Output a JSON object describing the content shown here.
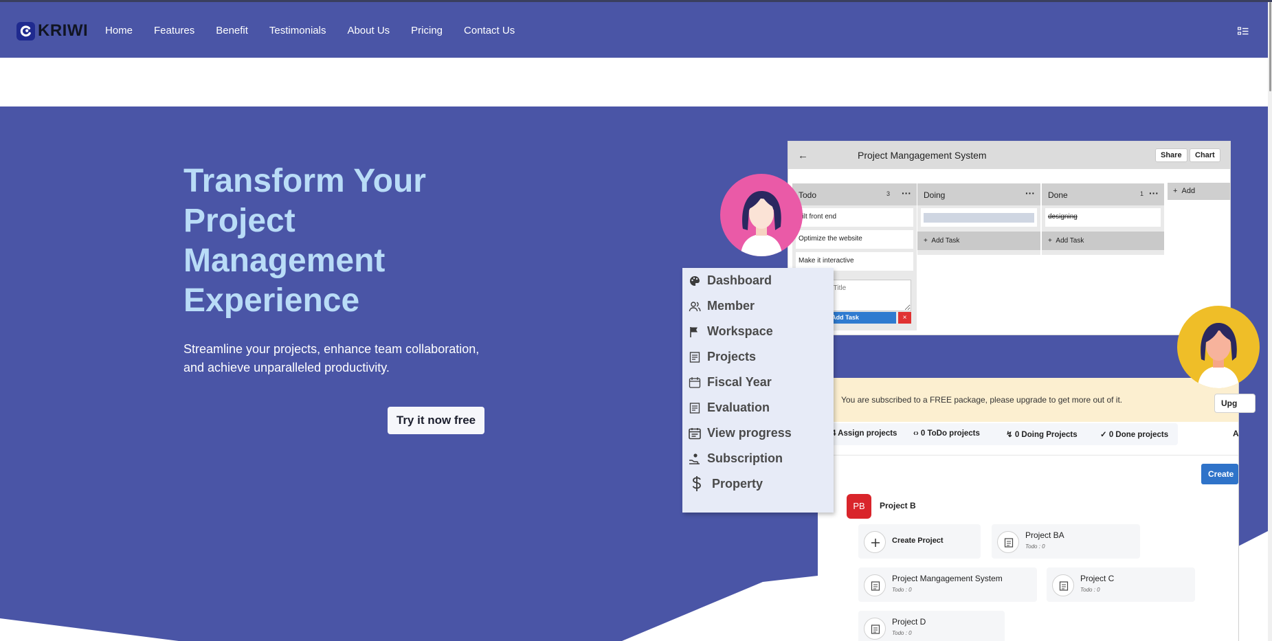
{
  "brand": {
    "name": "KRIWI",
    "logo_color": "#1f2a8f"
  },
  "nav": {
    "links": [
      "Home",
      "Features",
      "Benefit",
      "Testimonials",
      "About Us",
      "Pricing",
      "Contact Us"
    ],
    "menu_icon": "list-menu-icon",
    "background": "#4a55a6"
  },
  "hero": {
    "title_lines": [
      "Transform Your",
      "Project",
      "Management",
      "Experience"
    ],
    "subtitle": "Streamline your projects, enhance team collaboration, and achieve unparalleled productivity.",
    "cta": "Try it now free",
    "title_color": "#b9dcf7"
  },
  "board": {
    "title": "Project Mangagement System",
    "share": "Share",
    "chart": "Chart",
    "columns": [
      {
        "name": "Todo",
        "count": "3",
        "cards": [
          "uilt front end",
          "Optimize the website",
          "Make it interactive"
        ]
      },
      {
        "name": "Doing",
        "count": "",
        "cards": [
          ""
        ],
        "add": "Add Task"
      },
      {
        "name": "Done",
        "count": "1",
        "cards": [
          "designing"
        ],
        "add": "Add Task"
      }
    ],
    "task_placeholder": "Enter Task Title",
    "task_add": "Add Task",
    "task_close": "×",
    "add_column": "Add"
  },
  "sidebar": {
    "items": [
      {
        "label": "Dashboard",
        "icon": "palette-icon"
      },
      {
        "label": "Member",
        "icon": "users-icon"
      },
      {
        "label": "Workspace",
        "icon": "flag-icon"
      },
      {
        "label": "Projects",
        "icon": "document-icon"
      },
      {
        "label": "Fiscal Year",
        "icon": "calendar-icon"
      },
      {
        "label": "Evaluation",
        "icon": "document-icon"
      },
      {
        "label": "View progress",
        "icon": "calendar-list-icon"
      },
      {
        "label": "Subscription",
        "icon": "hand-coin-icon"
      },
      {
        "label": "Property",
        "icon": "dollar-icon"
      }
    ]
  },
  "dashboard": {
    "notice": "You are subscribed to a FREE package, please upgrade to get more out of it.",
    "upgrade": "Upg",
    "stats": [
      "4 Assign projects",
      "0 ToDo projects",
      "0 Doing Projects",
      "0 Done projects"
    ],
    "stats_extra": "A",
    "create": "Create",
    "project_group": {
      "initials": "PB",
      "name": "Project B"
    },
    "projects": [
      {
        "name": "Create Project",
        "sub": ""
      },
      {
        "name": "Project BA",
        "sub": "Todo : 0"
      },
      {
        "name": "Project Mangagement System",
        "sub": "Todo : 0"
      },
      {
        "name": "Project C",
        "sub": "Todo : 0"
      },
      {
        "name": "Project D",
        "sub": "Todo : 0"
      }
    ]
  }
}
